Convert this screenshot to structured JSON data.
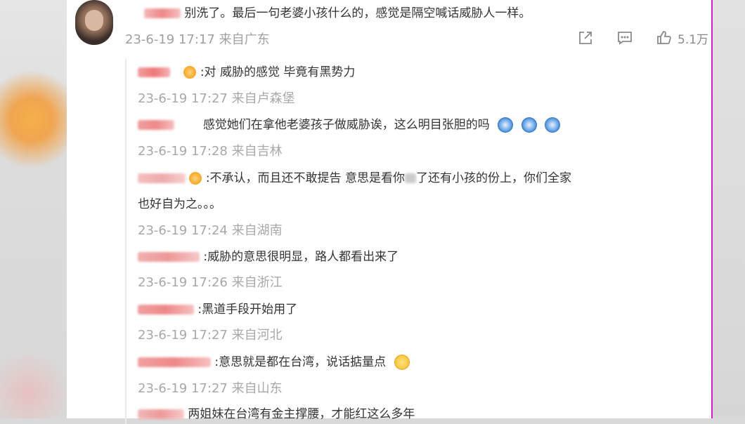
{
  "main_comment": {
    "text": "别洗了。最后一句老婆小孩什么的，感觉是隔空喊话威胁人一样。",
    "time": "23-6-19 17:17",
    "location": "来自广东",
    "like_count": "5.1万"
  },
  "replies": [
    {
      "text": ":对  威胁的感觉  毕竟有黑势力",
      "time": "23-6-19 17:27",
      "location": "来自卢森堡"
    },
    {
      "text": "感觉她们在拿他老婆孩子做威胁诶，这么明目张胆的吗",
      "time": "23-6-19 17:28",
      "location": "来自吉林"
    },
    {
      "text": ":不承认，而且还不敢提告  意思是看你",
      "text_b": "了还有小孩的份上，你们全家",
      "text2": "也好自为之。。。",
      "time": "23-6-19 17:24",
      "location": "来自湖南"
    },
    {
      "text": ":威胁的意思很明显，路人都看出来了",
      "time": "23-6-19 17:26",
      "location": "来自浙江"
    },
    {
      "text": ":黑道手段开始用了",
      "time": "23-6-19 17:27",
      "location": "来自河北"
    },
    {
      "text": ":意思就是都在台湾，说话掂量点",
      "time": "23-6-19 17:27",
      "location": "来自山东"
    },
    {
      "text": "两姐妹在台湾有金主撑腰，才能红这么多年"
    }
  ],
  "icons": {
    "share": "share-icon",
    "comment": "comment-icon",
    "like": "like-icon"
  },
  "colors": {
    "accent_border": "#d21ed2",
    "meta_gray": "#a0a0a0"
  }
}
